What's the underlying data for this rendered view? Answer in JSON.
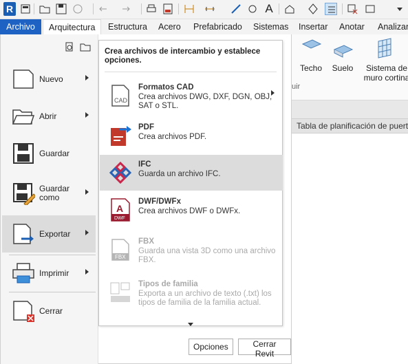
{
  "app_badge": "R",
  "tabs": {
    "file": "Archivo",
    "items": [
      "Arquitectura",
      "Estructura",
      "Acero",
      "Prefabricado",
      "Sistemas",
      "Insertar",
      "Anotar",
      "Analizar"
    ]
  },
  "ribbon": {
    "buttons": [
      "Techo",
      "Suelo",
      "Sistema de",
      "muro cortina"
    ],
    "panel_label_fragment": "uir",
    "schedule_tab": "Tabla de planificación de puertas"
  },
  "app_menu": {
    "left_items": [
      {
        "label": "Nuevo",
        "submenu": true
      },
      {
        "label": "Abrir",
        "submenu": true
      },
      {
        "label": "Guardar",
        "submenu": false
      },
      {
        "label": "Guardar como",
        "line1": "Guardar",
        "line2": "como",
        "submenu": true
      },
      {
        "label": "Exportar",
        "submenu": true,
        "selected": true
      },
      {
        "label": "Imprimir",
        "submenu": true
      },
      {
        "label": "Cerrar",
        "submenu": false
      }
    ],
    "submenu": {
      "header": "Crea archivos de intercambio y establece opciones.",
      "items": [
        {
          "title": "Formatos CAD",
          "desc": "Crea archivos DWG, DXF, DGN, OBJ, SAT o STL.",
          "submenu": true,
          "icon": "cad-icon"
        },
        {
          "title": "PDF",
          "desc": "Crea archivos PDF.",
          "icon": "pdf-icon"
        },
        {
          "title": "IFC",
          "desc": "Guarda un archivo IFC.",
          "icon": "ifc-icon",
          "highlighted": true
        },
        {
          "title": "DWF/DWFx",
          "desc": "Crea archivos DWF o DWFx.",
          "icon": "dwf-icon"
        },
        {
          "title": "FBX",
          "desc": "Guarda una vista 3D como una archivo FBX.",
          "icon": "fbx-icon",
          "disabled": true
        },
        {
          "title": "Tipos de familia",
          "desc": "Exporta a un archivo de texto (.txt) los tipos de familia de la familia actual.",
          "icon": "family-types-icon",
          "disabled": true
        }
      ]
    },
    "footer_buttons": {
      "options": "Opciones",
      "close": "Cerrar Revit"
    }
  },
  "colors": {
    "file_tab": "#1e63c4",
    "accent_blue": "#1a5fb4",
    "hover_grey": "#dcdcdc"
  }
}
